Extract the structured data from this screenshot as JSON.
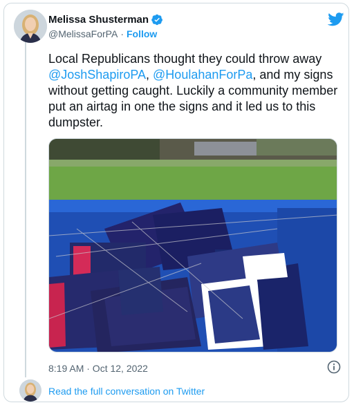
{
  "author": {
    "display_name": "Melissa Shusterman",
    "handle": "@MelissaForPA",
    "separator": "·",
    "follow_label": "Follow",
    "verified_icon": "verified-badge-icon",
    "avatar_icon": "profile-avatar"
  },
  "tweet": {
    "text_part1": "Local Republicans thought they could throw away ",
    "mention1": "@JoshShapiroPA",
    "text_part2": ", ",
    "mention2": "@HoulahanForPa",
    "text_part3": ", and my signs without getting caught. Luckily a community member put an airtag in one the signs and it led us to this dumpster.",
    "image_icon": "dumpster-photo",
    "timestamp": "8:19 AM · Oct 12, 2022"
  },
  "footer": {
    "read_more_label": "Read the full conversation on Twitter"
  },
  "colors": {
    "accent": "#1d9bf0",
    "text": "#0f1419",
    "muted": "#536471",
    "border": "#cfd9de"
  }
}
